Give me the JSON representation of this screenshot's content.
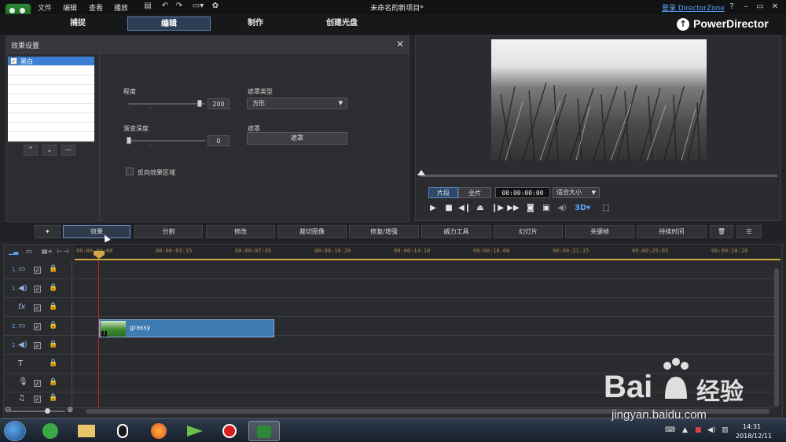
{
  "menu": {
    "file": "文件",
    "edit": "编辑",
    "view": "查看",
    "play": "播放"
  },
  "window": {
    "title": "未命名的新项目*",
    "login": "登录 DirectorZone",
    "help": "?"
  },
  "modes": {
    "capture": "捕捉",
    "edit": "编辑",
    "produce": "制作",
    "disc": "创建光盘"
  },
  "brand": "PowerDirector",
  "effect_panel": {
    "title": "效果设置",
    "effects": [
      "黑白"
    ],
    "degree_label": "程度",
    "degree_value": "200",
    "gradient_label": "渐变深度",
    "gradient_value": "0",
    "mask_type_label": "遮罩类型",
    "mask_type_value": "方形",
    "mask_label": "遮罩",
    "mask_button": "遮罩",
    "invert_label": "反向效果区域"
  },
  "preview": {
    "clip_tab": "片段",
    "full_tab": "全片",
    "timecode": "00:00:00:00",
    "fit": "适合大小"
  },
  "toolbar": {
    "effects": "效果",
    "split": "分割",
    "modify": "修改",
    "crop": "裁切图像",
    "fix": "修复/增强",
    "power_tools": "威力工具",
    "slideshow": "幻灯片",
    "keyframe": "关键帧",
    "duration": "持续时间"
  },
  "ruler": [
    "00:00:00:00",
    "00:00:03:15",
    "00:00:07:05",
    "00:00:10:20",
    "00:00:14:10",
    "00:00:18:00",
    "00:00:21:15",
    "00:00:25:05",
    "00:00:28:20"
  ],
  "tracks": [
    {
      "num": "1.",
      "icon": "video-track-icon"
    },
    {
      "num": "1.",
      "icon": "audio-track-icon"
    },
    {
      "num": "",
      "icon": "fx-track-icon"
    },
    {
      "num": "2.",
      "icon": "video-track-icon"
    },
    {
      "num": "2.",
      "icon": "audio-track-icon"
    },
    {
      "num": "",
      "icon": "title-track-icon"
    },
    {
      "num": "",
      "icon": "voice-track-icon"
    },
    {
      "num": "",
      "icon": "music-track-icon"
    }
  ],
  "clip": {
    "name": "grassy"
  },
  "taskbar": {
    "time": "14:31",
    "date": "2018/12/11"
  },
  "watermark": {
    "brand": "Bai",
    "cn": "经验",
    "url": "jingyan.baidu.com"
  }
}
